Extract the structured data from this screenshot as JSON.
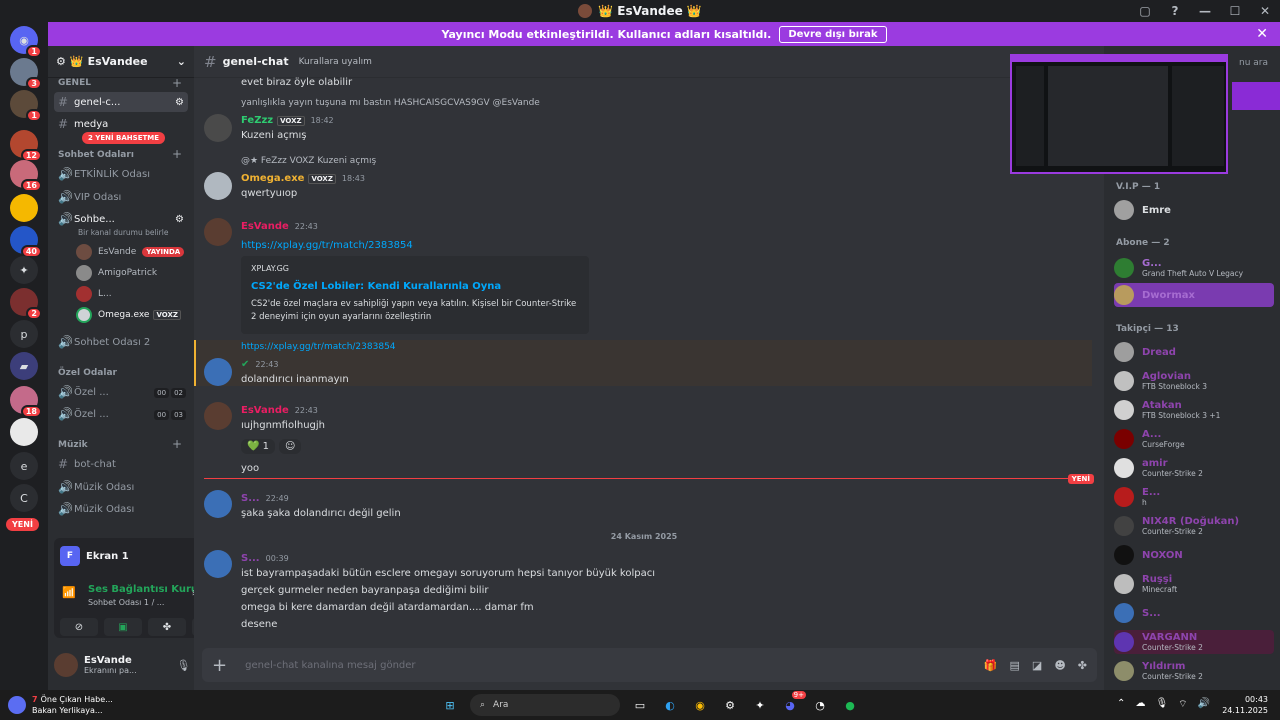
{
  "window": {
    "title": "EsVandee",
    "title_emoji": "👑"
  },
  "streamer_bar": {
    "text": "Yayıncı Modu etkinleştirildi. Kullanıcı adları kısaltıldı.",
    "button": "Devre dışı bırak"
  },
  "guilds": {
    "badges": [
      "1",
      "3",
      "1",
      "12",
      "16",
      "40",
      "2",
      "18"
    ],
    "letters": [
      "p",
      "e",
      "C"
    ],
    "new_pill": "YENİ"
  },
  "server": {
    "name": "EsVandee",
    "mention_pill": "2 YENİ BAHSETME",
    "categories": {
      "general": "GENEL",
      "voice": "Sohbet Odaları",
      "private": "Özel Odalar",
      "music": "Müzik"
    },
    "channels": {
      "genel_chat": "genel-c...",
      "medya": "medya",
      "etkinlik": "ETKİNLİK Odası",
      "vip": "VIP Odası",
      "sohbet1": "Sohbe...",
      "sohbet1_status": "Bir kanal durumu belirle",
      "sohbet2": "Sohbet Odası 2",
      "ozel1": "Özel ...",
      "ozel2": "Özel ...",
      "ozel1_counts": [
        "00",
        "02"
      ],
      "ozel2_counts": [
        "00",
        "03"
      ],
      "bot_chat": "bot-chat",
      "muzik1": "Müzik Odası",
      "muzik2": "Müzik Odası"
    },
    "voice_users": [
      {
        "name": "EsVande",
        "live": "YAYINDA"
      },
      {
        "name": "AmigoPatrick"
      },
      {
        "name": "L..."
      },
      {
        "name": "Omega.exe",
        "tag": "VOXZ"
      }
    ]
  },
  "panel": {
    "screen": "Ekran 1",
    "screen_letter": "F",
    "voice_status": "Ses Bağlantısı Kuru",
    "voice_sub": "Sohbet Odası 1 / ...",
    "user": "EsVande",
    "user_status": "Ekranını pa..."
  },
  "chat": {
    "channel": "genel-chat",
    "topic": "Kurallara uyalım",
    "search_placeholder": "nu ara",
    "messages": [
      {
        "text": "evet biraz öyle olabilir"
      },
      {
        "reply": "yanlışlıkla yayın tuşuna mı bastın HASHCAISGCVAS9GV @EsVande",
        "user": "FeZzz",
        "tag": "VOXZ",
        "time": "18:42",
        "text": "Kuzeni açmış"
      },
      {
        "reply": "@★ FeZzz  VOXZ  Kuzeni açmış",
        "user": "Omega.exe",
        "tag": "VOXZ",
        "time": "18:43",
        "text": "qwertyuıop"
      },
      {
        "user": "EsVande",
        "time": "22:43",
        "link": "https://xplay.gg/tr/match/2383854",
        "embed": {
          "provider": "XPLAY.GG",
          "title": "CS2'de Özel Lobiler: Kendi Kurallarınla Oyna",
          "desc": "CS2'de özel maçlara ev sahipliği yapın veya katılın. Kişisel bir Counter-Strike 2 deneyimi için oyun ayarlarını özelleştirin"
        }
      },
      {
        "reply": "https://xplay.gg/tr/match/2383854",
        "time": "22:43",
        "text": "dolandırıcı inanmayın"
      },
      {
        "user": "EsVande",
        "time": "22:43",
        "text": "ıujhgnmfiolhugjh",
        "reaction_count": "1",
        "text2": "yoo"
      },
      {
        "user": "S...",
        "time": "22:49",
        "text": "şaka şaka dolandırıcı değil gelin"
      },
      {
        "user": "S...",
        "time": "00:39",
        "lines": [
          "ist bayrampaşadaki bütün esclere omegayı soruyorum hepsi tanıyor büyük kolpacı",
          "gerçek gurmeler neden bayranpaşa dediğimi bilir",
          "omega bi kere damardan değil atardamardan.... damar fm",
          "desene"
        ]
      }
    ],
    "new_label": "YENİ",
    "date_divider": "24 Kasım 2025",
    "composer_placeholder": "genel-chat kanalına mesaj gönder"
  },
  "members": {
    "groups": [
      {
        "label": "V.I.P — 1",
        "items": [
          {
            "name": "Emre",
            "color": "#dbdee1"
          }
        ]
      },
      {
        "label": "Abone — 2",
        "items": [
          {
            "name": "G...",
            "act": "Grand Theft Auto V Legacy",
            "color": "#a66cd1"
          },
          {
            "name": "Dwormax",
            "color": "#a66cd1"
          }
        ]
      },
      {
        "label": "Takipçi — 13",
        "items": [
          {
            "name": "Dread",
            "color": "#8e44ad"
          },
          {
            "name": "Aglovian",
            "act": "FTB Stoneblock 3",
            "color": "#8e44ad"
          },
          {
            "name": "Atakan",
            "act": "FTB Stoneblock 3 +1",
            "color": "#8e44ad"
          },
          {
            "name": "A...",
            "act": "CurseForge",
            "color": "#8e44ad"
          },
          {
            "name": "amir",
            "act": "Counter-Strike 2",
            "color": "#8e44ad"
          },
          {
            "name": "E...",
            "act": "h",
            "color": "#8e44ad"
          },
          {
            "name": "NIX4R (Doğukan)",
            "act": "Counter-Strike 2",
            "color": "#8e44ad"
          },
          {
            "name": "NOXON",
            "color": "#8e44ad"
          },
          {
            "name": "Ruşşi",
            "act": "Minecraft",
            "color": "#8e44ad"
          },
          {
            "name": "S...",
            "color": "#8e44ad"
          },
          {
            "name": "VARGANN",
            "act": "Counter-Strike 2",
            "color": "#8e44ad"
          },
          {
            "name": "Yıldırım",
            "act": "Counter-Strike 2",
            "color": "#8e44ad"
          }
        ]
      }
    ]
  },
  "taskbar": {
    "news_title": "Öne Çıkan Habe...",
    "news_sub": "Bakan Yerlikaya...",
    "news_badge": "7",
    "search": "Ara",
    "discord_badge": "9+",
    "time": "00:43",
    "date": "24.11.2025"
  },
  "colors": {
    "accent": "#9b3be0",
    "danger": "#f23f43",
    "link": "#00a8fc",
    "online": "#23a55a"
  }
}
